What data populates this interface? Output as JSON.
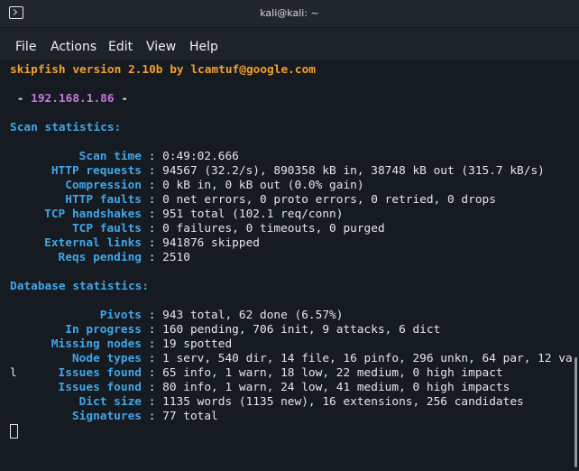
{
  "window": {
    "title": "kali@kali: ~"
  },
  "menu": [
    "File",
    "Actions",
    "Edit",
    "View",
    "Help"
  ],
  "terminal": {
    "signature": "skipfish version 2.10b by lcamtuf@google.com",
    "target_prefix": " - ",
    "target_ip": "192.168.1.86",
    "target_suffix": " -",
    "scan_header": "Scan statistics:",
    "scan_stats": [
      {
        "label": "Scan time",
        "value": "0:49:02.666"
      },
      {
        "label": "HTTP requests",
        "value": "94567 (32.2/s), 890358 kB in, 38748 kB out (315.7 kB/s)"
      },
      {
        "label": "Compression",
        "value": "0 kB in, 0 kB out (0.0% gain)"
      },
      {
        "label": "HTTP faults",
        "value": "0 net errors, 0 proto errors, 0 retried, 0 drops"
      },
      {
        "label": "TCP handshakes",
        "value": "951 total (102.1 req/conn)"
      },
      {
        "label": "TCP faults",
        "value": "0 failures, 0 timeouts, 0 purged"
      },
      {
        "label": "External links",
        "value": "941876 skipped"
      },
      {
        "label": "Reqs pending",
        "value": "2510"
      }
    ],
    "db_header": "Database statistics:",
    "db_stats": [
      {
        "label": "Pivots",
        "value": "943 total, 62 done (6.57%)"
      },
      {
        "label": "In progress",
        "value": "160 pending, 706 init, 9 attacks, 6 dict"
      },
      {
        "label": "Missing nodes",
        "value": "19 spotted"
      },
      {
        "label": "Node types",
        "value": "1 serv, 540 dir, 14 file, 16 pinfo, 296 unkn, 64 par, 12 va"
      },
      {
        "label": "Issues found",
        "value": "65 info, 1 warn, 18 low, 22 medium, 0 high impact",
        "wrap_prefix": "l"
      },
      {
        "label": "Issues found",
        "value": "80 info, 1 warn, 24 low, 41 medium, 0 high impacts"
      },
      {
        "label": "Dict size",
        "value": "1135 words (1135 new), 16 extensions, 256 candidates"
      },
      {
        "label": "Signatures",
        "value": "77 total"
      }
    ]
  }
}
